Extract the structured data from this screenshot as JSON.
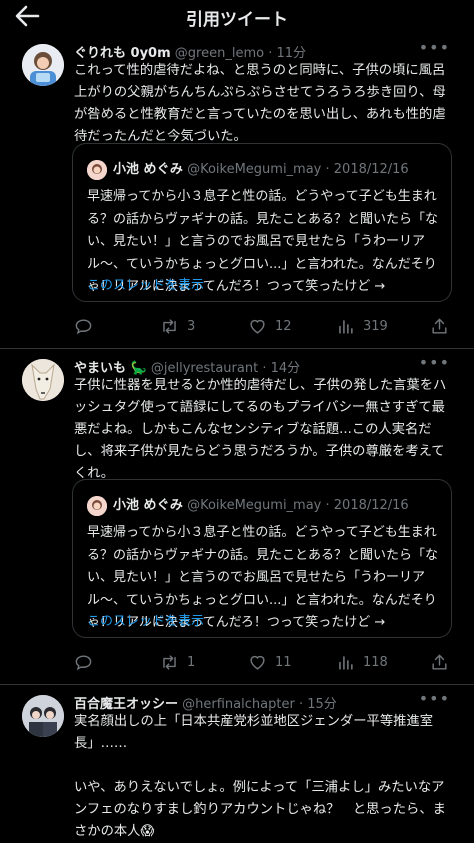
{
  "header": {
    "title": "引用ツイート"
  },
  "tweets": [
    {
      "name": "ぐりれも 0y0m",
      "handle": "@green_lemo",
      "time": "· 11分",
      "text": "これって性的虐待だよね、と思うのと同時に、子供の頃に風呂上がりの父親がちんちんぷらぷらさせてうろうろ歩き回り、母が咎めると性教育だと言っていたのを思い出し、あれも性的虐待だったんだと今気づいた。",
      "quote": {
        "name": "小池 めぐみ",
        "handle": "@KoikeMegumi_may",
        "date": "· 2018/12/16",
        "text": "早速帰ってから小３息子と性の話。どうやって子ども生まれる？の話からヴァギナの話。見たことある？と聞いたら「ない、見たい！」と言うのでお風呂で見せたら「うわーリアル〜、ていうかちょっとグロい...」と言われた。なんだそりゃ！リアルに決まってんだろ！つって笑ったけど →",
        "thread_link": "このスレッドを表示"
      },
      "stats": {
        "reply": "",
        "retweet": "3",
        "like": "12",
        "views": "319"
      }
    },
    {
      "name": "やまいも 🦕",
      "handle": "@jellyrestaurant",
      "time": "· 14分",
      "text": "子供に性器を見せるとか性的虐待だし、子供の発した言葉をハッシュタグ使って語録にしてるのもプライバシー無さすぎて最悪だよね。しかもこんなセンシティブな話題...この人実名だし、将来子供が見たらどう思うだろうか。子供の尊厳を考えてくれ。",
      "quote": {
        "name": "小池 めぐみ",
        "handle": "@KoikeMegumi_may",
        "date": "· 2018/12/16",
        "text": "早速帰ってから小３息子と性の話。どうやって子ども生まれる？の話からヴァギナの話。見たことある？と聞いたら「ない、見たい！」と言うのでお風呂で見せたら「うわーリアル〜、ていうかちょっとグロい...」と言われた。なんだそりゃ！リアルに決まってんだろ！つって笑ったけど →",
        "thread_link": "このスレッドを表示"
      },
      "stats": {
        "reply": "",
        "retweet": "1",
        "like": "11",
        "views": "118"
      }
    },
    {
      "name": "百合魔王オッシー",
      "handle": "@herfinalchapter",
      "time": "· 15分",
      "text_lines": [
        "実名顔出しの上「日本共産党杉並地区ジェンダー平等推進室長」……",
        "",
        "いや、ありえないでしょ。例によって「三浦よし」みたいなアンフェのなりすまし釣りアカウントじゃね？　と思ったら、まさかの本人😱"
      ]
    }
  ],
  "colors": {
    "background": "#000000",
    "text": "#e7e9ea",
    "secondary": "#71767b",
    "link": "#1d9bf0",
    "border": "#2f3336"
  }
}
